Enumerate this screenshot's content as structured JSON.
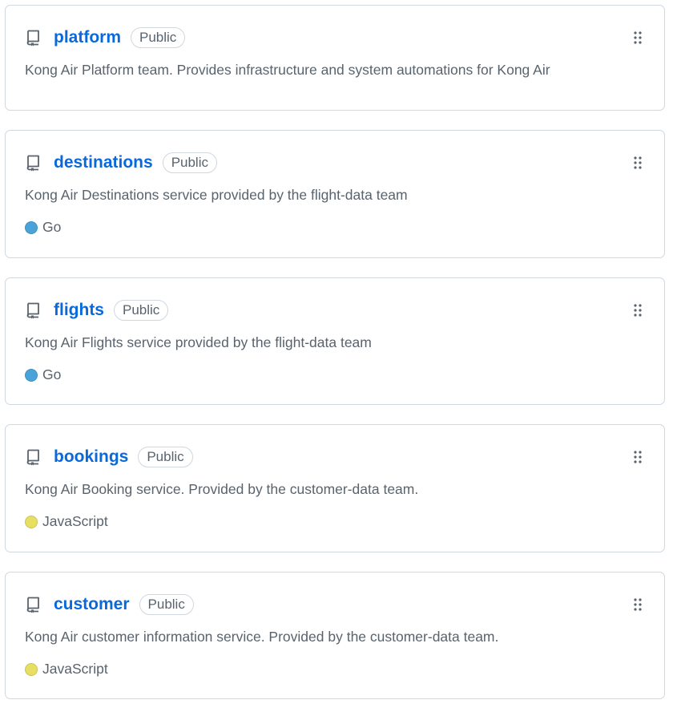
{
  "colors": {
    "link": "#0969da",
    "border": "#d0d7de",
    "muted_text": "#59636e",
    "go": "#4aa3d8",
    "javascript": "#e6df62"
  },
  "repos": [
    {
      "name": "platform",
      "visibility": "Public",
      "description": "Kong Air Platform team. Provides infrastructure and system automations for Kong Air",
      "language": null,
      "icon": "repo-icon"
    },
    {
      "name": "destinations",
      "visibility": "Public",
      "description": "Kong Air Destinations service provided by the flight-data team",
      "language": "Go",
      "language_color": "#4aa3d8",
      "icon": "repo-icon"
    },
    {
      "name": "flights",
      "visibility": "Public",
      "description": "Kong Air Flights service provided by the flight-data team",
      "language": "Go",
      "language_color": "#4aa3d8",
      "icon": "repo-icon"
    },
    {
      "name": "bookings",
      "visibility": "Public",
      "description": "Kong Air Booking service. Provided by the customer-data team.",
      "language": "JavaScript",
      "language_color": "#e6df62",
      "icon": "repo-icon"
    },
    {
      "name": "customer",
      "visibility": "Public",
      "description": "Kong Air customer information service. Provided by the customer-data team.",
      "language": "JavaScript",
      "language_color": "#e6df62",
      "icon": "repo-icon"
    }
  ]
}
